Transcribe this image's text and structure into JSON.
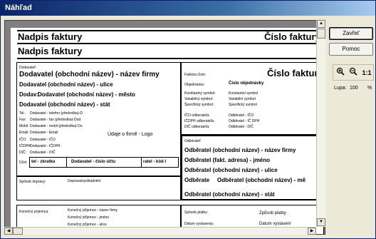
{
  "window": {
    "title": "Náhľad"
  },
  "buttons": {
    "close": "Zavřeť",
    "help": "Pomoc"
  },
  "zoom": {
    "label": "Lupa:",
    "value": "100",
    "unit": "%",
    "one_to_one": "1:1"
  },
  "invoice": {
    "title1": "Nadpis faktury",
    "number1": "Číslo faktury",
    "title2": "Nadpis faktury",
    "supplier": {
      "label": "Dodavateľ:",
      "name": "Dodavatel (obchodní název) - název firmy",
      "street": "Dodavatel (obchodní název) - ulice",
      "city_prefix": "Dodav:",
      "city": "Dodavatel (obchodní název) - město",
      "state": "Dodavatel (obchodní název) - stát",
      "tel_label": "Tel.:",
      "tel": "Dodavatel - telefon (předvolba)-D",
      "fax_label": "Fax:",
      "fax": "Dodavatel - fax (předvolba)-Dod",
      "mob_label": "Mobil:",
      "mob": "Dodavatel - mobil (předvolba)-Do",
      "email_label": "Email",
      "email": "Dodavatel - Email",
      "ico_label": "IČO:",
      "ico": "Dodavatel - IČO",
      "icdph_label": "IČDPH",
      "icdph": "Dodavatel - IČDPH",
      "dic_label": "DIČ:",
      "dic": "Dodavatel - DIČ",
      "logo_info": "Údaje o firmě - Logo",
      "account_label": "Účet",
      "bank_code_left": "tel - zkratku",
      "account_number": "Dodavatel - číslo účtu",
      "bank_code_right": "ratel - kód I",
      "shipping_label": "Spôsob dopravy:",
      "shipping_value": "Doprava/vyskladnění"
    },
    "right": {
      "number_label": "Faktúra číslo:",
      "number_value": "Číslo faktury",
      "order_label": "Objednávka:",
      "order_value": "Číslo objednávky",
      "konst_label": "Konštantný symbol:",
      "konst": "Konstantní symbol",
      "var_label": "Variabilný symbol:",
      "var": "Variabilní symbol",
      "spec_label": "Špecifický symbol:",
      "spec": "Specifický symbol",
      "ico_label": "IČO odberateľa:",
      "ico": "Odběratel - IČO",
      "icdph_label": "IČDPH odberateľa:",
      "icdph": "Odběratel - IČ DPH",
      "dic_label": "DIČ odberateľa:",
      "dic": "Odběratel - DIČ"
    },
    "customer": {
      "label": "Odberateľ:",
      "name": "Odběratel (obchodní název) - název firmy",
      "billing": "Odběratel (fakt. adresa) - jméno",
      "street": "Odběratel (obchodní název) - ulice",
      "city_prefix": "Odběrate",
      "city": "Odběratel (obchodní název) - mě",
      "state": "Odběratel (obchodní název) - stát"
    },
    "final": {
      "label": "Konečný príjemca:",
      "line1": "Konečný příjemce - název firmy",
      "line2": "Konečný příjemce - jméno",
      "line3": "Konečný příjemce - ulice"
    },
    "payment": {
      "method_label": "Spôsob platby:",
      "method_value": "Způsob platby",
      "date_label": "Dátum vystavenia:",
      "date_value": "Datum vystavení"
    }
  }
}
